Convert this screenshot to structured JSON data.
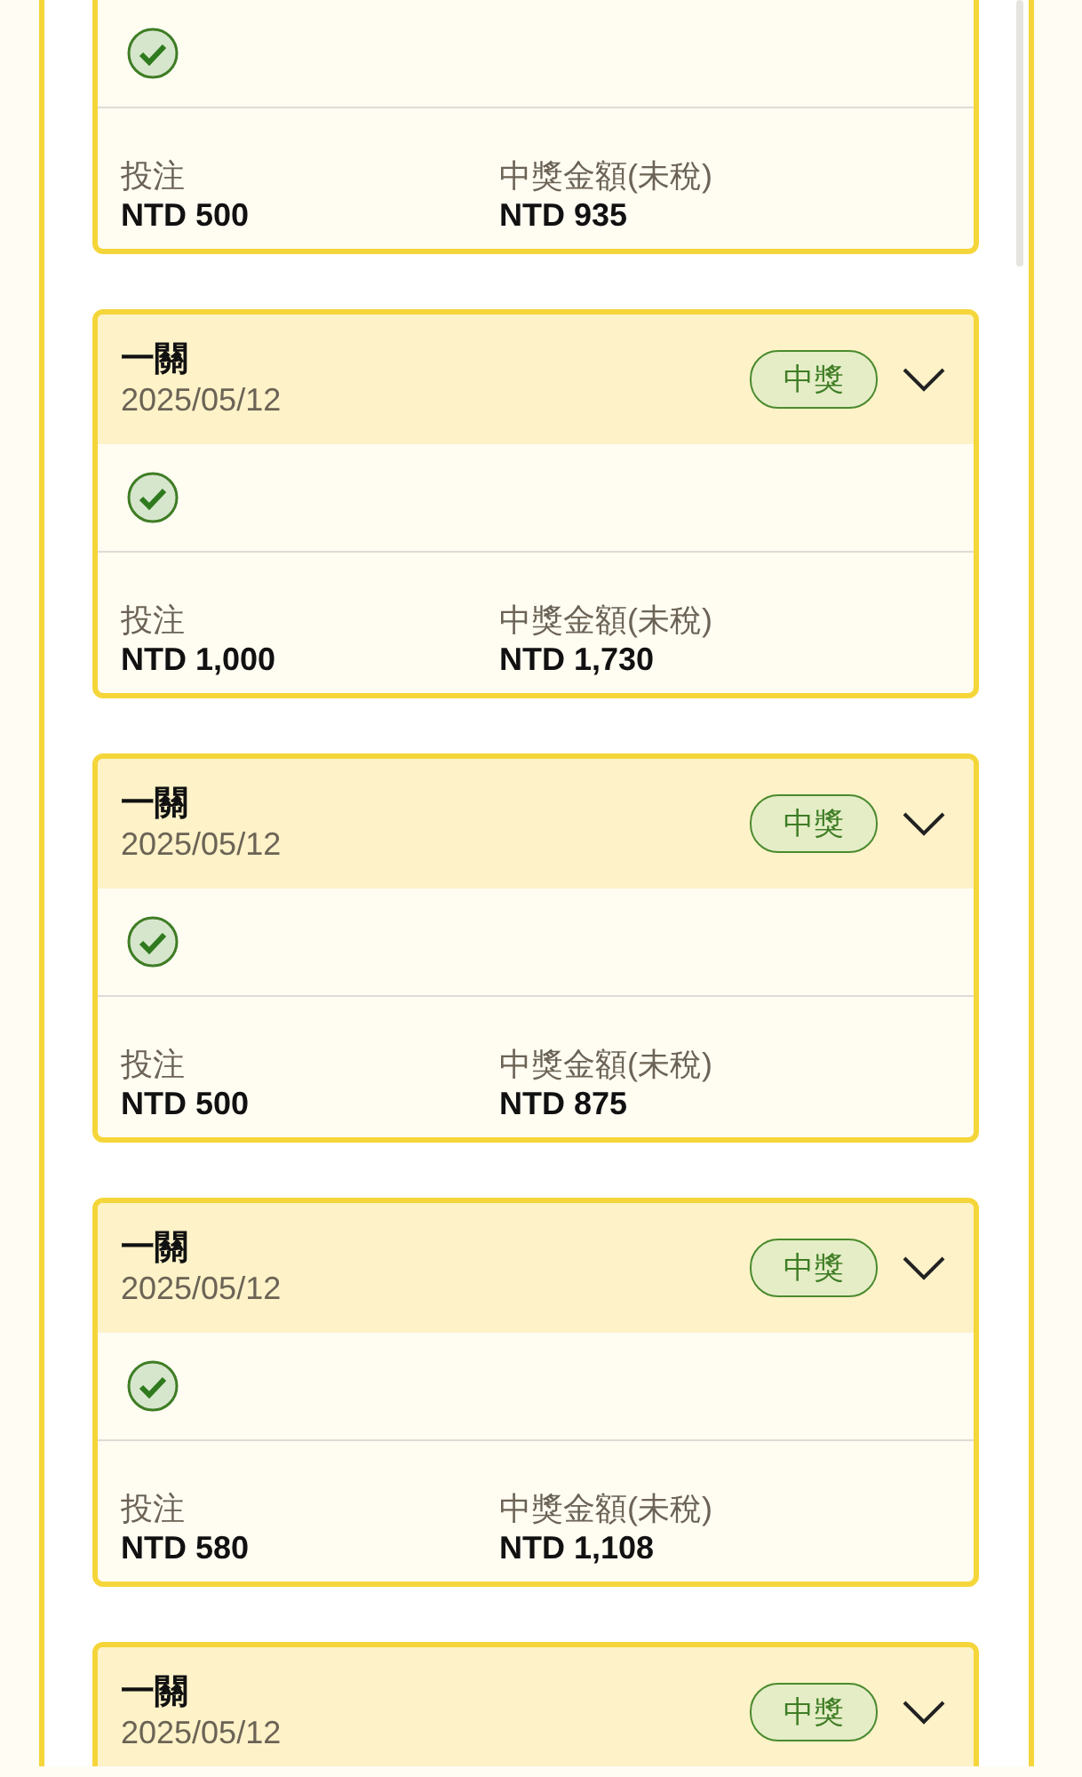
{
  "cards": [
    {
      "checked": true,
      "stake_label": "投注",
      "stake": "NTD 500",
      "prize_label": "中獎金額(未稅)",
      "prize": "NTD 935"
    },
    {
      "title": "一關",
      "date": "2025/05/12",
      "badge": "中獎",
      "expanded": false,
      "checked": true,
      "stake_label": "投注",
      "stake": "NTD 1,000",
      "prize_label": "中獎金額(未稅)",
      "prize": "NTD 1,730"
    },
    {
      "title": "一關",
      "date": "2025/05/12",
      "badge": "中獎",
      "expanded": false,
      "checked": true,
      "stake_label": "投注",
      "stake": "NTD 500",
      "prize_label": "中獎金額(未稅)",
      "prize": "NTD 875"
    },
    {
      "title": "一關",
      "date": "2025/05/12",
      "badge": "中獎",
      "expanded": false,
      "checked": true,
      "stake_label": "投注",
      "stake": "NTD 580",
      "prize_label": "中獎金額(未稅)",
      "prize": "NTD 1,108"
    },
    {
      "title": "一關",
      "date": "2025/05/12",
      "badge": "中獎",
      "expanded": false
    }
  ]
}
